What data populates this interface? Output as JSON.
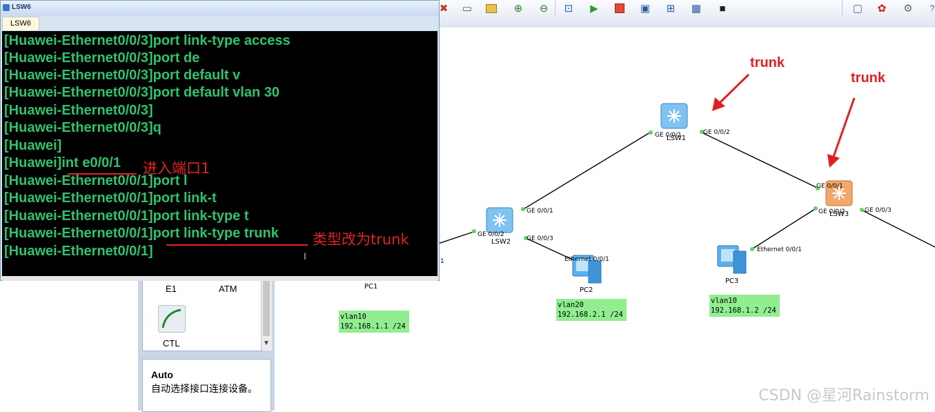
{
  "toolbar": {
    "icons": [
      "delete-icon",
      "text-comment-icon",
      "rectangle-icon",
      "zoom-in-icon",
      "zoom-out-icon",
      "fit-window-icon",
      "start-device-icon",
      "stop-device-icon",
      "capture-icon",
      "topology-icon",
      "table-icon",
      "console-icon"
    ],
    "right_icons": [
      "chat-icon",
      "huawei-logo-icon",
      "settings-icon",
      "help-icon"
    ]
  },
  "terminal": {
    "title": "LSW6",
    "tab_label": "LSW6",
    "lines": [
      "[Huawei-Ethernet0/0/3]port link-type access",
      "[Huawei-Ethernet0/0/3]port de",
      "[Huawei-Ethernet0/0/3]port default v",
      "[Huawei-Ethernet0/0/3]port default vlan 30",
      "[Huawei-Ethernet0/0/3]",
      "[Huawei-Ethernet0/0/3]q",
      "[Huawei]",
      "[Huawei]int e0/0/1",
      "[Huawei-Ethernet0/0/1]port l",
      "[Huawei-Ethernet0/0/1]port link-t",
      "[Huawei-Ethernet0/0/1]port link-type t",
      "[Huawei-Ethernet0/0/1]port link-type trunk",
      "[Huawei-Ethernet0/0/1]"
    ],
    "note_port": "进入端口1",
    "note_type": "类型改为trunk"
  },
  "topology": {
    "annotations": [
      "trunk",
      "trunk"
    ],
    "devices": {
      "lsw1": "LSW1",
      "lsw2": "LSW2",
      "lsw3": "LSW3",
      "pc1": "PC1",
      "pc2": "PC2",
      "pc3": "PC3"
    },
    "ports": {
      "lsw1_left": "GE 0/0/1",
      "lsw1_right": "GE 0/0/2",
      "lsw2_up": "GE 0/0/1",
      "lsw2_left": "GE 0/0/2",
      "lsw2_down": "GE 0/0/3",
      "lsw3_up": "GE 0/0/1",
      "lsw3_left": "GE 0/0/2",
      "lsw3_right": "GE 0/0/3",
      "pc1_port": "1",
      "pc2_port": "Ethernet 0/0/1",
      "pc3_port": "Ethernet 0/0/1"
    },
    "vlan_boxes": [
      {
        "vlan": "vlan10",
        "ip": "192.168.1.1 /24"
      },
      {
        "vlan": "vlan20",
        "ip": "192.168.2.1 /24"
      },
      {
        "vlan": "vlan10",
        "ip": "192.168.1.2 /24"
      }
    ]
  },
  "palette": {
    "items": [
      "E1",
      "ATM",
      "CTL"
    ],
    "desc_title": "Auto",
    "desc_text": "自动选择接口连接设备。"
  },
  "watermark": "CSDN @星河Rainstorm"
}
